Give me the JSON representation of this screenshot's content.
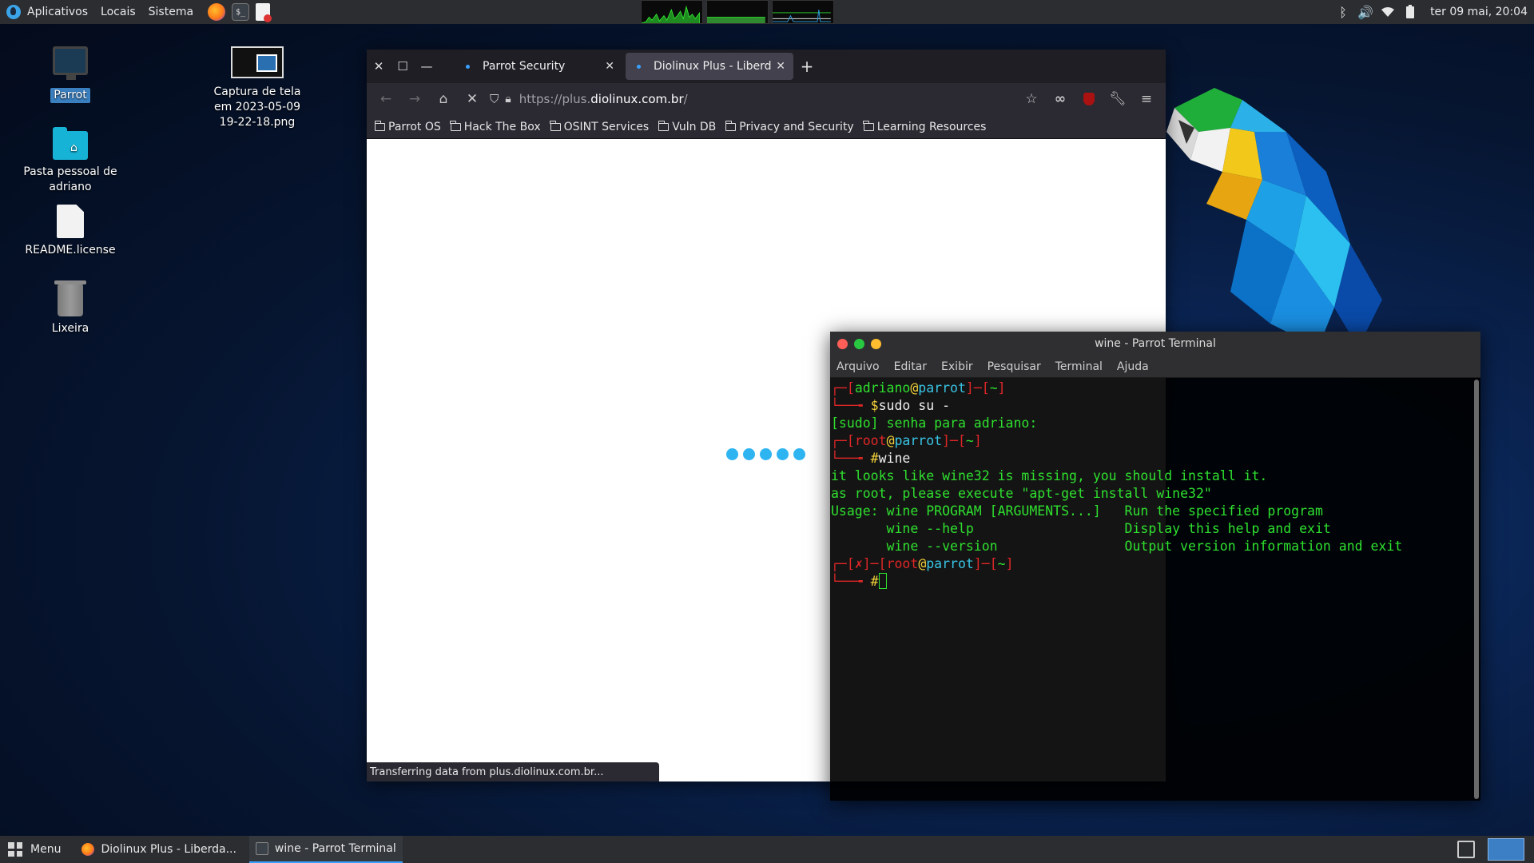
{
  "top_panel": {
    "applications": "Aplicativos",
    "places": "Locais",
    "system": "Sistema",
    "clock": "ter 09 mai, 20:04"
  },
  "desktop": {
    "icons": [
      {
        "label": "Parrot"
      },
      {
        "label": "Captura de tela em 2023-05-09 19-22-18.png"
      },
      {
        "label": "Pasta pessoal de adriano"
      },
      {
        "label": "README.license"
      },
      {
        "label": "Lixeira"
      }
    ]
  },
  "browser": {
    "tabs": [
      {
        "label": "Parrot Security"
      },
      {
        "label": "Diolinux Plus - Liberdade"
      }
    ],
    "url": {
      "scheme": "https://plus.",
      "host": "diolinux.com.br",
      "path": "/"
    },
    "bookmarks": [
      {
        "label": "Parrot OS"
      },
      {
        "label": "Hack The Box"
      },
      {
        "label": "OSINT Services"
      },
      {
        "label": "Vuln DB"
      },
      {
        "label": "Privacy and Security"
      },
      {
        "label": "Learning Resources"
      }
    ],
    "status": "Transferring data from plus.diolinux.com.br...",
    "accent": "#2fb4f2"
  },
  "terminal": {
    "title": "wine - Parrot Terminal",
    "menu": [
      "Arquivo",
      "Editar",
      "Exibir",
      "Pesquisar",
      "Terminal",
      "Ajuda"
    ],
    "lines": {
      "l1_user": "adriano",
      "l1_host": "parrot",
      "l1_dir": "~",
      "l2_cmd": "sudo su -",
      "l3": "[sudo] senha para adriano:",
      "l4_user": "root",
      "l4_host": "parrot",
      "l4_dir": "~",
      "l5_cmd": "wine",
      "l6": "it looks like wine32 is missing, you should install it.",
      "l7": "as root, please execute \"apt-get install wine32\"",
      "l8": "Usage: wine PROGRAM [ARGUMENTS...]   Run the specified program",
      "l9": "       wine --help                   Display this help and exit",
      "l10": "       wine --version                Output version information and exit",
      "l11_flag": "✗",
      "l11_user": "root",
      "l11_host": "parrot",
      "l11_dir": "~"
    },
    "colors": {
      "prompt_frame": "#e02727",
      "output": "#2fe02f",
      "host": "#39c6e6"
    }
  },
  "taskbar": {
    "menu": "Menu",
    "tasks": [
      {
        "label": "Diolinux Plus - Liberda..."
      },
      {
        "label": "wine - Parrot Terminal"
      }
    ]
  }
}
